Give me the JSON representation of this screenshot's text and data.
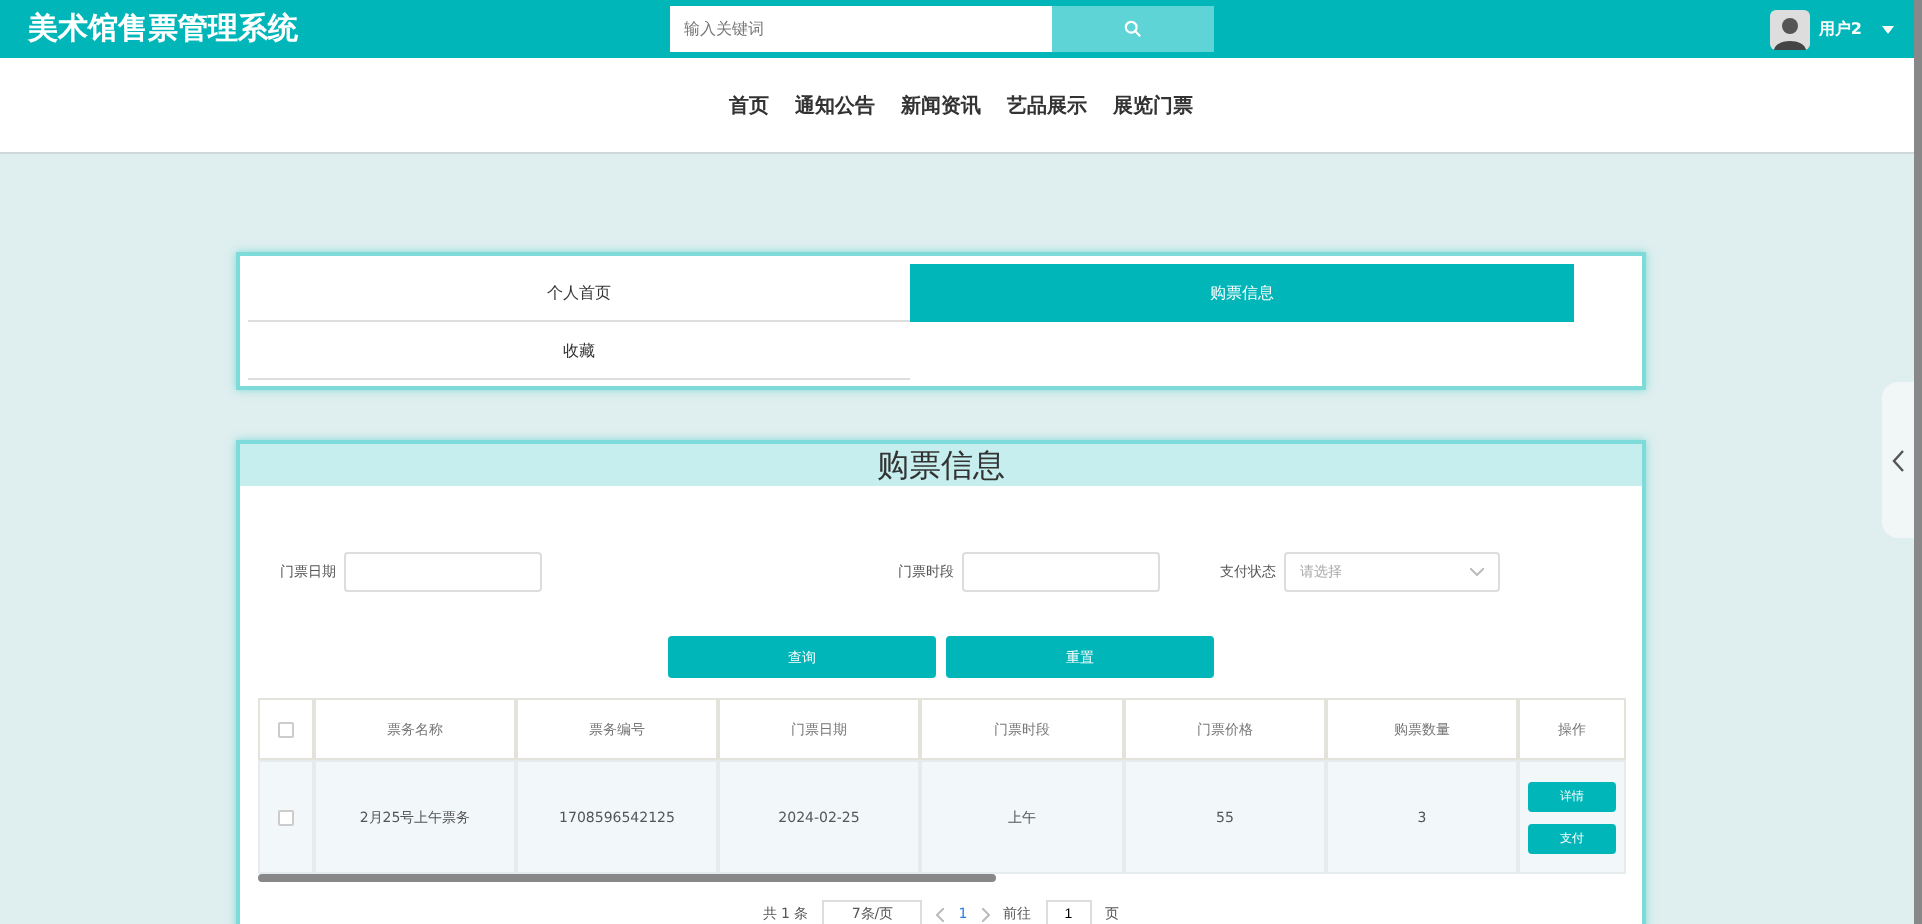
{
  "header": {
    "title": "美术馆售票管理系统",
    "search": {
      "placeholder": "输入关键词"
    },
    "user": {
      "name": "用户2"
    }
  },
  "nav": [
    {
      "label": "首页"
    },
    {
      "label": "通知公告"
    },
    {
      "label": "新闻资讯"
    },
    {
      "label": "艺品展示"
    },
    {
      "label": "展览门票"
    }
  ],
  "tabs": [
    {
      "label": "个人首页",
      "selected": false
    },
    {
      "label": "购票信息",
      "selected": true
    },
    {
      "label": "收藏",
      "selected": false
    }
  ],
  "panel": {
    "title": "购票信息",
    "filters": [
      {
        "label": "门票日期",
        "kind": "text"
      },
      {
        "label": "门票时段",
        "kind": "text"
      },
      {
        "label": "支付状态",
        "kind": "select",
        "placeholder": "请选择"
      }
    ],
    "buttons": [
      "查询",
      "重置"
    ],
    "table": {
      "select_all": {
        "checked": false
      },
      "columns": [
        "票务名称",
        "票务编号",
        "门票日期",
        "门票时段",
        "门票价格",
        "购票数量",
        "操作"
      ],
      "rows": [
        {
          "checked": false,
          "cells": [
            "2月25号上午票务",
            "1708596542125",
            "2024-02-25",
            "上午",
            "55",
            "3"
          ],
          "actions": [
            "详情",
            "支付"
          ]
        }
      ]
    },
    "pagination": {
      "total": "共 1 条",
      "page_size": "7条/页",
      "pages": [
        {
          "label": "1",
          "selected": true
        }
      ],
      "goto_label": "前往",
      "goto_value": "1",
      "goto_unit": "页"
    }
  }
}
